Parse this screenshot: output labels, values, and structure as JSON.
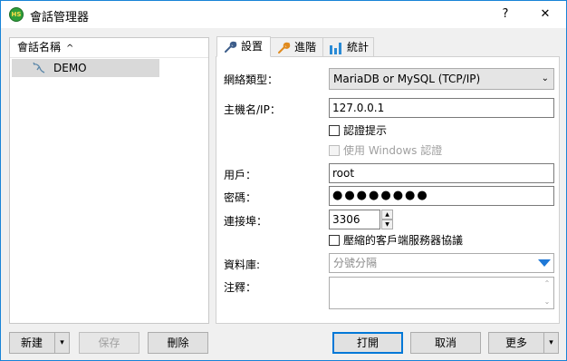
{
  "window": {
    "app_icon_text": "HS",
    "title": "會話管理器",
    "help_label": "?",
    "close_label": "✕"
  },
  "tree": {
    "header": "會話名稱",
    "sort_indicator": "^",
    "sessions": [
      {
        "name": "DEMO",
        "icon": "mysql-dolphin-icon"
      }
    ]
  },
  "left_buttons": {
    "new": "新建",
    "new_arrow": "▾",
    "save": "保存",
    "delete": "刪除"
  },
  "tabs": [
    {
      "label": "設置",
      "icon": "wrench-icon",
      "active": true
    },
    {
      "label": "進階",
      "icon": "wrench-orange-icon",
      "active": false
    },
    {
      "label": "統計",
      "icon": "bar-chart-icon",
      "active": false
    }
  ],
  "form": {
    "network_type_label": "網絡類型：",
    "network_type_value": "MariaDB or MySQL (TCP/IP)",
    "host_label": "主機名/IP：",
    "host_value": "127.0.0.1",
    "prompt_credentials_label": "認證提示",
    "windows_auth_label": "使用 Windows 認證",
    "user_label": "用戶：",
    "user_value": "root",
    "password_label": "密碼：",
    "password_value": "●●●●●●●●",
    "port_label": "連接埠：",
    "port_value": "3306",
    "compressed_label": "壓縮的客戶端服務器協議",
    "database_label": "資料庫:",
    "database_placeholder": "分號分隔",
    "comment_label": "注釋："
  },
  "bottom_buttons": {
    "open": "打開",
    "cancel": "取消",
    "more": "更多",
    "more_arrow": "▾"
  },
  "colors": {
    "accent": "#0078d7",
    "dropdown_triangle": "#1e78d7",
    "selected_row": "#d9d9d9"
  }
}
